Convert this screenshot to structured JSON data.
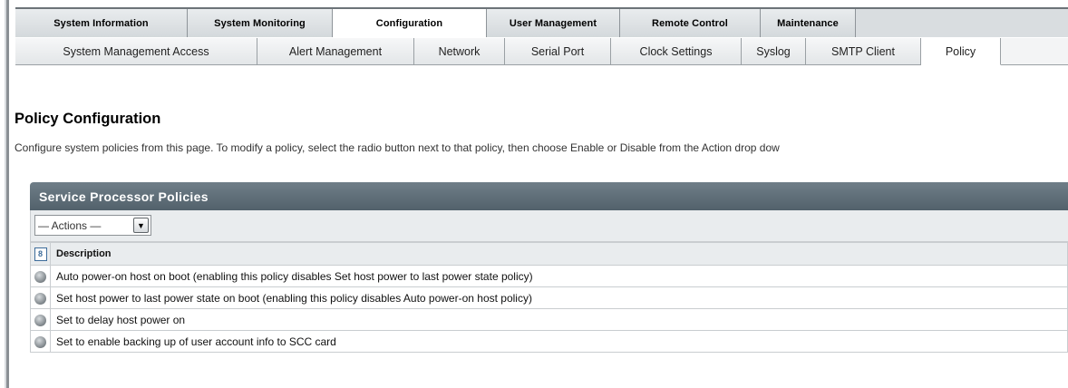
{
  "primary_tabs": [
    {
      "label": "System Information",
      "active": false
    },
    {
      "label": "System Monitoring",
      "active": false
    },
    {
      "label": "Configuration",
      "active": true
    },
    {
      "label": "User Management",
      "active": false
    },
    {
      "label": "Remote Control",
      "active": false
    },
    {
      "label": "Maintenance",
      "active": false
    }
  ],
  "secondary_tabs": [
    {
      "label": "System Management Access",
      "active": false
    },
    {
      "label": "Alert Management",
      "active": false
    },
    {
      "label": "Network",
      "active": false
    },
    {
      "label": "Serial Port",
      "active": false
    },
    {
      "label": "Clock Settings",
      "active": false
    },
    {
      "label": "Syslog",
      "active": false
    },
    {
      "label": "SMTP Client",
      "active": false
    },
    {
      "label": "Policy",
      "active": true
    }
  ],
  "page": {
    "title": "Policy Configuration",
    "description": "Configure system policies from this page. To modify a policy, select the radio button next to that policy, then choose Enable or Disable from the Action drop dow"
  },
  "panel": {
    "title": "Service Processor Policies",
    "actions_label": "— Actions —",
    "actions_arrow": "▼",
    "select_all_icon": "8",
    "column_header": "Description",
    "rows": [
      {
        "description": "Auto power-on host on boot (enabling this policy disables Set host power to last power state policy)"
      },
      {
        "description": "Set host power to last power state on boot (enabling this policy disables Auto power-on host policy)"
      },
      {
        "description": "Set to delay host power on"
      },
      {
        "description": "Set to enable backing up of user account info to SCC card"
      }
    ]
  },
  "colors": {
    "panel_header": "#5f6e78",
    "tab_active": "#ffffff",
    "tab_inactive": "#dde1e3"
  }
}
